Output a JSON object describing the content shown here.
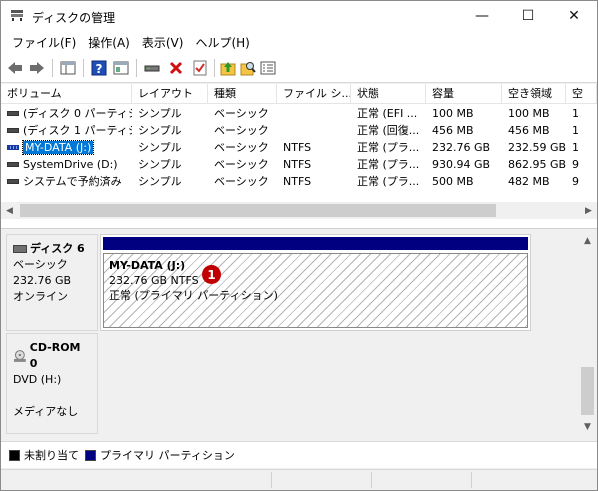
{
  "window": {
    "title": "ディスクの管理",
    "controls": {
      "minimize": "—",
      "maximize": "☐",
      "close": "✕"
    }
  },
  "menu": [
    {
      "label": "ファイル(F)"
    },
    {
      "label": "操作(A)"
    },
    {
      "label": "表示(V)"
    },
    {
      "label": "ヘルプ(H)"
    }
  ],
  "toolbar": {
    "icons": [
      "back-icon",
      "forward-icon",
      "console-tree-icon",
      "help-icon",
      "show-hide-icon",
      "connect-drive-icon",
      "delete-icon",
      "properties-icon",
      "up-icon",
      "search-icon",
      "list-icon"
    ]
  },
  "volume_list": {
    "columns": [
      "ボリューム",
      "レイアウト",
      "種類",
      "ファイル シ...",
      "状態",
      "容量",
      "空き領域",
      "空"
    ],
    "rows": [
      {
        "cells": [
          "(ディスク 0 パーティシ...",
          "シンプル",
          "ベーシック",
          "",
          "正常 (EFI ...",
          "100 MB",
          "100 MB",
          "1"
        ],
        "selected": false
      },
      {
        "cells": [
          "(ディスク 1 パーティシ...",
          "シンプル",
          "ベーシック",
          "",
          "正常 (回復...",
          "456 MB",
          "456 MB",
          "1"
        ],
        "selected": false
      },
      {
        "cells": [
          "MY-DATA (J:)",
          "シンプル",
          "ベーシック",
          "NTFS",
          "正常 (プラ...",
          "232.76 GB",
          "232.59 GB",
          "1"
        ],
        "selected": true
      },
      {
        "cells": [
          "SystemDrive (D:)",
          "シンプル",
          "ベーシック",
          "NTFS",
          "正常 (プラ...",
          "930.94 GB",
          "862.95 GB",
          "9"
        ],
        "selected": false
      },
      {
        "cells": [
          "システムで予約済み",
          "シンプル",
          "ベーシック",
          "NTFS",
          "正常 (プラ...",
          "500 MB",
          "482 MB",
          "9"
        ],
        "selected": false
      }
    ]
  },
  "disks": [
    {
      "name": "ディスク 6",
      "type": "ベーシック",
      "size": "232.76 GB",
      "status": "オンライン",
      "partition": {
        "name": "MY-DATA (J:)",
        "size_fs": "232.76 GB NTFS",
        "status": "正常 (プライマリ パーティション)"
      },
      "badge": "1"
    },
    {
      "name": "CD-ROM 0",
      "type": "DVD (H:)",
      "size": "",
      "status": "メディアなし"
    }
  ],
  "legend": [
    {
      "label": "未割り当て",
      "color": "#000000"
    },
    {
      "label": "プライマリ パーティション",
      "color": "#000080"
    }
  ],
  "colors": {
    "partition_bar": "#000080",
    "selection": "#0078d7",
    "badge": "#c00000"
  }
}
